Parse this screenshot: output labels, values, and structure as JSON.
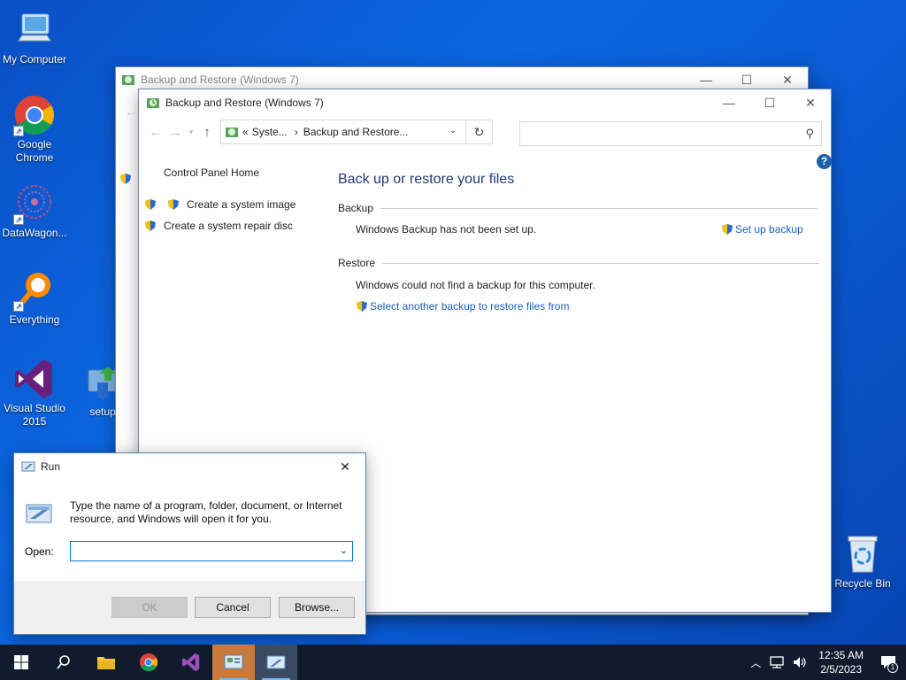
{
  "desktop": {
    "icons": [
      {
        "label": "My Computer"
      },
      {
        "label": "Google Chrome"
      },
      {
        "label": "DataWagon..."
      },
      {
        "label": "Everything"
      },
      {
        "label": "Visual Studio 2015"
      },
      {
        "label": "setup"
      },
      {
        "label": "Recycle Bin"
      }
    ]
  },
  "bg_window": {
    "title": "Backup and Restore (Windows 7)"
  },
  "main_window": {
    "title": "Backup and Restore (Windows 7)",
    "address": {
      "prefix": "«",
      "crumb1": "Syste...",
      "separator": "›",
      "crumb2": "Backup and Restore..."
    },
    "search_placeholder": "",
    "sidebar": {
      "home": "Control Panel Home",
      "items": [
        {
          "label": "Create a system image"
        },
        {
          "label": "Create a system repair disc"
        }
      ]
    },
    "heading": "Back up or restore your files",
    "backup": {
      "head": "Backup",
      "status": "Windows Backup has not been set up.",
      "action": "Set up backup"
    },
    "restore": {
      "head": "Restore",
      "status": "Windows could not find a backup for this computer.",
      "action": "Select another backup to restore files from"
    }
  },
  "run_dialog": {
    "title": "Run",
    "description": "Type the name of a program, folder, document, or Internet resource, and Windows will open it for you.",
    "open_label": "Open:",
    "open_value": "",
    "ok_label": "OK",
    "cancel_label": "Cancel",
    "browse_label": "Browse..."
  },
  "taskbar": {
    "time": "12:35 AM",
    "date": "2/5/2023",
    "notification_count": "1"
  },
  "colors": {
    "accent": "#1a5fb4",
    "desktop": "#0b66e0",
    "taskbar": "#101c2e"
  }
}
